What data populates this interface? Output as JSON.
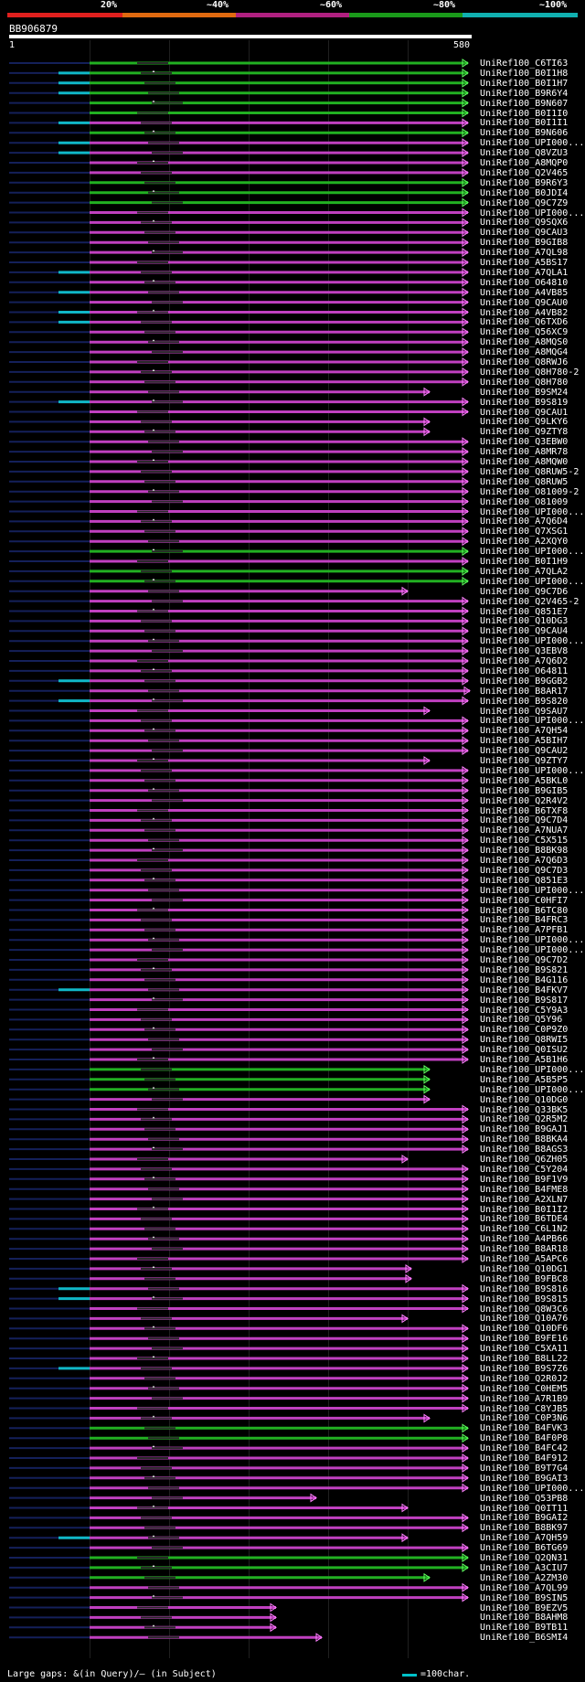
{
  "header": {
    "pct_labels": [
      "20%",
      "~40%",
      "~60%",
      "~80%",
      "~100%"
    ],
    "pct_colors": [
      "#e0201e",
      "#e06a10",
      "#b02080",
      "#1a9a1a",
      "#10b0b0"
    ],
    "query_id": "BB906879",
    "query_start": "1",
    "query_end": "580"
  },
  "subjects": [
    "UniRef100_C6TI63",
    "UniRef100_B0I1H8",
    "UniRef100_B0I1H7",
    "UniRef100_B9R6Y4",
    "UniRef100_B9N607",
    "UniRef100_B0I1I0",
    "UniRef100_B0I1I1",
    "UniRef100_B9N606",
    "UniRef100_UPI000...",
    "UniRef100_Q8VZU3",
    "UniRef100_A8MQP0",
    "UniRef100_Q2V465",
    "UniRef100_B9R6Y3",
    "UniRef100_B0JDI4",
    "UniRef100_Q9C7Z9",
    "UniRef100_UPI000...",
    "UniRef100_Q9SQX6",
    "UniRef100_Q9CAU3",
    "UniRef100_B9GIB8",
    "UniRef100_A7QL98",
    "UniRef100_A5BS17",
    "UniRef100_A7QLA1",
    "UniRef100_O64810",
    "UniRef100_A4VB85",
    "UniRef100_Q9CAU0",
    "UniRef100_A4VB82",
    "UniRef100_Q6TXD6",
    "UniRef100_Q56XC9",
    "UniRef100_A8MQS0",
    "UniRef100_A8MQG4",
    "UniRef100_Q8RWJ6",
    "UniRef100_Q8H780-2",
    "UniRef100_Q8H780",
    "UniRef100_B9SM24",
    "UniRef100_B9S819",
    "UniRef100_Q9CAU1",
    "UniRef100_Q9LKY6",
    "UniRef100_Q9ZTY8",
    "UniRef100_Q3EBW0",
    "UniRef100_A8MR78",
    "UniRef100_A8MQW0",
    "UniRef100_Q8RUW5-2",
    "UniRef100_Q8RUW5",
    "UniRef100_O81009-2",
    "UniRef100_O81009",
    "UniRef100_UPI000...",
    "UniRef100_A7Q6D4",
    "UniRef100_Q7XSG1",
    "UniRef100_A2XQY0",
    "UniRef100_UPI000...",
    "UniRef100_B0I1H9",
    "UniRef100_A7QLA2",
    "UniRef100_UPI000...",
    "UniRef100_Q9C7D6",
    "UniRef100_Q2V465-2",
    "UniRef100_Q851E7",
    "UniRef100_Q10DG3",
    "UniRef100_Q9CAU4",
    "UniRef100_UPI000...",
    "UniRef100_Q3EBV8",
    "UniRef100_A7Q6D2",
    "UniRef100_O64811",
    "UniRef100_B9GGB2",
    "UniRef100_B8AR17",
    "UniRef100_B9S820",
    "UniRef100_Q9SAU7",
    "UniRef100_UPI000...",
    "UniRef100_A7QH54",
    "UniRef100_A5BIH7",
    "UniRef100_Q9CAU2",
    "UniRef100_Q9ZTY7",
    "UniRef100_UPI000...",
    "UniRef100_A5BKL0",
    "UniRef100_B9GIB5",
    "UniRef100_Q2R4V2",
    "UniRef100_B6TXF8",
    "UniRef100_Q9C7D4",
    "UniRef100_A7NUA7",
    "UniRef100_C5X515",
    "UniRef100_B8BK98",
    "UniRef100_A7Q6D3",
    "UniRef100_Q9C7D3",
    "UniRef100_Q851E3",
    "UniRef100_UPI000...",
    "UniRef100_C0HFI7",
    "UniRef100_B6TC80",
    "UniRef100_B4FRC3",
    "UniRef100_A7PFB1",
    "UniRef100_UPI000...",
    "UniRef100_UPI000...",
    "UniRef100_Q9C7D2",
    "UniRef100_B9S821",
    "UniRef100_B4G116",
    "UniRef100_B4FKV7",
    "UniRef100_B9S817",
    "UniRef100_C5Y9A3",
    "UniRef100_Q5Y96",
    "UniRef100_C0P9Z0",
    "UniRef100_Q8RWI5",
    "UniRef100_Q0ISU2",
    "UniRef100_A5B1H6",
    "UniRef100_UPI000...",
    "UniRef100_A5B5P5",
    "UniRef100_UPI000...",
    "UniRef100_Q10DG0",
    "UniRef100_Q33BK5",
    "UniRef100_Q2R5M2",
    "UniRef100_B9GAJ1",
    "UniRef100_B8BKA4",
    "UniRef100_B8AGS3",
    "UniRef100_Q6ZH05",
    "UniRef100_C5Y204",
    "UniRef100_B9F1V9",
    "UniRef100_B4FME8",
    "UniRef100_A2XLN7",
    "UniRef100_B0I1I2",
    "UniRef100_B6TDE4",
    "UniRef100_C6L1N2",
    "UniRef100_A4PB66",
    "UniRef100_B8AR18",
    "UniRef100_A5APC6",
    "UniRef100_Q10DG1",
    "UniRef100_B9FBC8",
    "UniRef100_B9S816",
    "UniRef100_B9S815",
    "UniRef100_Q8W3C6",
    "UniRef100_Q10A76",
    "UniRef100_Q10DF6",
    "UniRef100_B9FE16",
    "UniRef100_C5XA11",
    "UniRef100_B8LL22",
    "UniRef100_B9S7Z6",
    "UniRef100_Q2R0J2",
    "UniRef100_C0HEM5",
    "UniRef100_A7R1B9",
    "UniRef100_C8YJB5",
    "UniRef100_C0P3N6",
    "UniRef100_B4FVK3",
    "UniRef100_B4F0P8",
    "UniRef100_B4FC42",
    "UniRef100_B4F912",
    "UniRef100_B9T7G4",
    "UniRef100_B9GAI3",
    "UniRef100_UPI000...",
    "UniRef100_Q53PB8",
    "UniRef100_Q0IT11",
    "UniRef100_B9GAI2",
    "UniRef100_B8BK97",
    "UniRef100_A7QH59",
    "UniRef100_B6TG69",
    "UniRef100_Q2QN31",
    "UniRef100_A3CIU7",
    "UniRef100_A2ZM30",
    "UniRef100_A7QL99",
    "UniRef100_B9SIN5",
    "UniRef100_B9EZV5",
    "UniRef100_B8AHM8",
    "UniRef100_B9TB11",
    "UniRef100_B6SMI4"
  ],
  "footer": {
    "gaps_legend": "Large gaps: &(in Query)/– (in Subject)",
    "scale_legend": "=100char."
  }
}
